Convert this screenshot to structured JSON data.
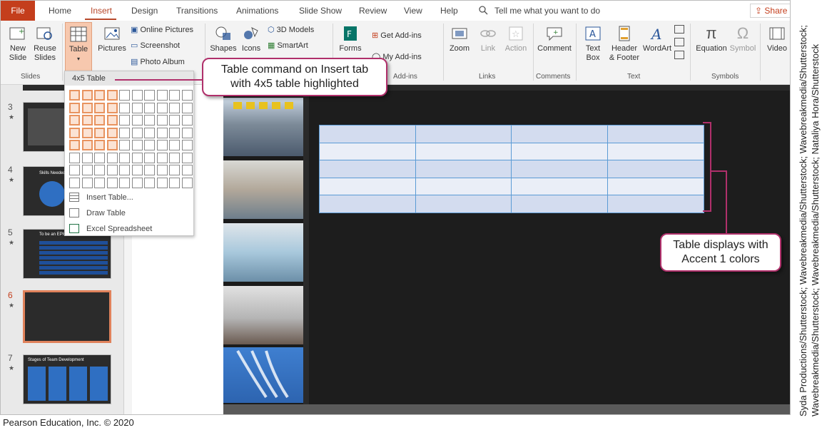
{
  "tabs": {
    "file": "File",
    "home": "Home",
    "insert": "Insert",
    "design": "Design",
    "transitions": "Transitions",
    "animations": "Animations",
    "slideshow": "Slide Show",
    "review": "Review",
    "view": "View",
    "help": "Help",
    "tell_me": "Tell me what you want to do",
    "share": "Share"
  },
  "ribbon": {
    "new_slide": "New Slide",
    "new_slide_1": "New",
    "new_slide_2": "Slide",
    "reuse_1": "Reuse",
    "reuse_2": "Slides",
    "table": "Table",
    "pictures": "Pictures",
    "online_pictures": "Online Pictures",
    "screenshot": "Screenshot",
    "photo_album": "Photo Album",
    "shapes": "Shapes",
    "icons": "Icons",
    "models_3d": "3D Models",
    "smartart": "SmartArt",
    "forms": "Forms",
    "get_addins": "Get Add-ins",
    "my_addins": "My Add-ins",
    "zoom": "Zoom",
    "link": "Link",
    "action": "Action",
    "comment": "Comment",
    "textbox_1": "Text",
    "textbox_2": "Box",
    "header_1": "Header",
    "header_2": "& Footer",
    "wordart": "WordArt",
    "equation": "Equation",
    "symbol": "Symbol",
    "video": "Video",
    "groups": {
      "slides": "Slides",
      "addins": "Add-ins",
      "links": "Links",
      "comments": "Comments",
      "text": "Text",
      "symbols": "Symbols"
    }
  },
  "dropdown": {
    "header": "4x5 Table",
    "grid_cols": 10,
    "grid_rows": 8,
    "highlight_cols": 4,
    "highlight_rows": 5,
    "items": [
      {
        "label": "Insert Table...",
        "icon": "insert-table-icon"
      },
      {
        "label": "Draw Table",
        "icon": "draw-table-icon"
      },
      {
        "label": "Excel Spreadsheet",
        "icon": "excel-spreadsheet-icon"
      }
    ]
  },
  "slides": [
    {
      "number": "3",
      "star": "★"
    },
    {
      "number": "4",
      "star": "★"
    },
    {
      "number": "5",
      "star": "★"
    },
    {
      "number": "6",
      "star": "★",
      "selected": true
    },
    {
      "number": "7",
      "star": "★"
    }
  ],
  "thumb_text": {
    "s4_title": "Skills Needed",
    "s5_title": "To be an EPIC ...",
    "s7_title": "Stages of Team Development"
  },
  "table_on_slide": {
    "columns": 4,
    "rows": 5,
    "style": "Accent 1"
  },
  "callouts": {
    "table_command_1": "Table command on Insert tab",
    "table_command_2": "with 4x5 table highlighted",
    "accent_1": "Table displays with",
    "accent_2": "Accent 1 colors"
  },
  "credits": {
    "vertical": "Syda Productions/Shutterstock; Wavebreakmedia/Shutterstock; Wavebreakmedia/Shutterstock; Wavebreakmedia/Shutterstock; Wavebreakmedia/Shutterstock; Nataliya Hora/Shutterstock",
    "copyright": "Pearson Education, Inc. © 2020"
  },
  "colors": {
    "accent": "#b7472a",
    "file_tab": "#c43e1c",
    "callout_border": "#b0306b",
    "table_border": "#5b9bd5",
    "highlight": "#e8935f"
  }
}
